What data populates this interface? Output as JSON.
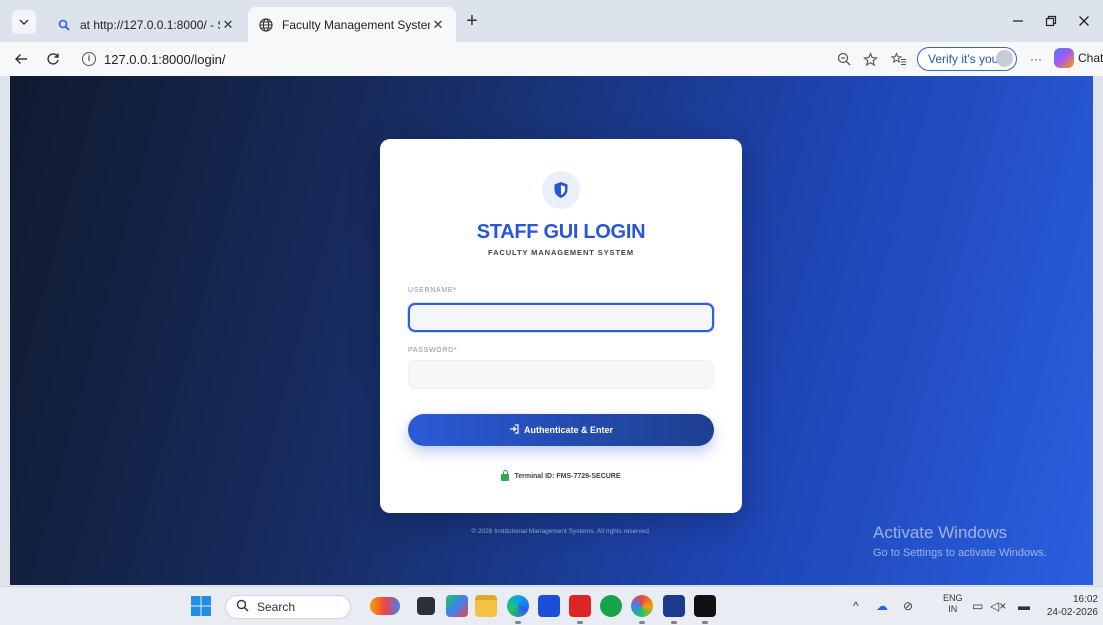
{
  "browser": {
    "tabs": [
      {
        "label": "at http://127.0.0.1:8000/ - Search",
        "icon": "search-icon",
        "active": false
      },
      {
        "label": "Faculty Management System",
        "icon": "globe-icon",
        "active": true
      }
    ],
    "address": {
      "url": "127.0.0.1:8000/login/"
    },
    "verify_label": "Verify it's you",
    "more_label": "···",
    "copilot_label": "Chat"
  },
  "login": {
    "title": "STAFF GUI LOGIN",
    "subtitle": "FACULTY MANAGEMENT SYSTEM",
    "username_label": "USERNAME*",
    "username_value": "",
    "password_label": "PASSWORD*",
    "password_value": "",
    "submit_label": "Authenticate & Enter",
    "submit_icon": "login-arrow-icon",
    "terminal_id": "Terminal ID: FMS-7729-SECURE",
    "footer": "© 2026 Institutional Management Systems. All rights reserved.",
    "accent_color": "#2856d8"
  },
  "watermark": {
    "title": "Activate Windows",
    "subtitle": "Go to Settings to activate Windows."
  },
  "taskbar": {
    "search_label": "Search",
    "language_top": "ENG",
    "language_bottom": "IN",
    "time": "16:02",
    "date": "24-02-2026"
  }
}
